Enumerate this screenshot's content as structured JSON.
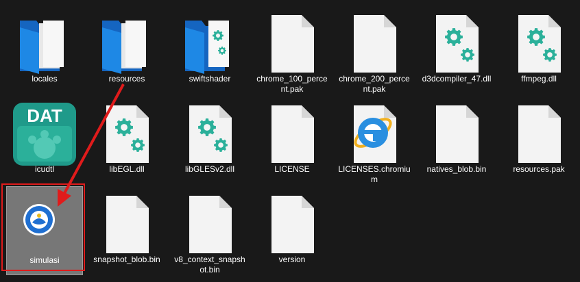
{
  "files": [
    {
      "name": "locales",
      "type": "folder"
    },
    {
      "name": "resources",
      "type": "folder"
    },
    {
      "name": "swiftshader",
      "type": "folder-gear"
    },
    {
      "name": "chrome_100_percent.pak",
      "type": "file"
    },
    {
      "name": "chrome_200_percent.pak",
      "type": "file"
    },
    {
      "name": "d3dcompiler_47.dll",
      "type": "dll"
    },
    {
      "name": "ffmpeg.dll",
      "type": "dll"
    },
    {
      "name": "icudtl",
      "type": "dat"
    },
    {
      "name": "libEGL.dll",
      "type": "dll-file"
    },
    {
      "name": "libGLESv2.dll",
      "type": "dll-file"
    },
    {
      "name": "LICENSE",
      "type": "file"
    },
    {
      "name": "LICENSES.chromium",
      "type": "ie"
    },
    {
      "name": "natives_blob.bin",
      "type": "file"
    },
    {
      "name": "resources.pak",
      "type": "file"
    },
    {
      "name": "simulasi",
      "type": "app",
      "selected": true
    },
    {
      "name": "snapshot_blob.bin",
      "type": "file"
    },
    {
      "name": "v8_context_snapshot.bin",
      "type": "file"
    },
    {
      "name": "version",
      "type": "file"
    }
  ],
  "icon_text": {
    "dat": "DAT"
  },
  "colors": {
    "background": "#191919",
    "folder": "#1e88e5",
    "gear": "#2bb09a",
    "annotation": "#e01b1b",
    "selection": "#777777"
  }
}
